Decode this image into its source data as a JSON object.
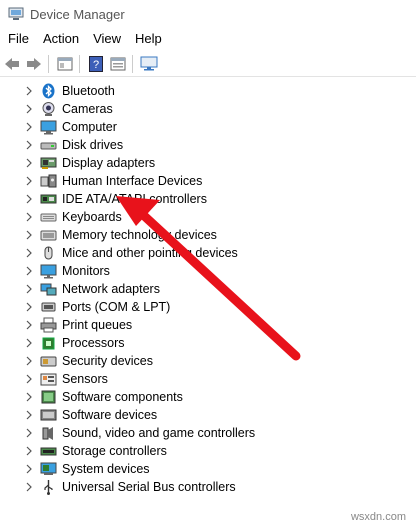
{
  "window": {
    "title": "Device Manager"
  },
  "menu": [
    "File",
    "Action",
    "View",
    "Help"
  ],
  "devices": [
    {
      "label": "Bluetooth",
      "icon": "bluetooth-icon"
    },
    {
      "label": "Cameras",
      "icon": "camera-icon"
    },
    {
      "label": "Computer",
      "icon": "computer-icon"
    },
    {
      "label": "Disk drives",
      "icon": "disk-drive-icon"
    },
    {
      "label": "Display adapters",
      "icon": "display-adapter-icon"
    },
    {
      "label": "Human Interface Devices",
      "icon": "hid-icon"
    },
    {
      "label": "IDE ATA/ATAPI controllers",
      "icon": "ide-controller-icon"
    },
    {
      "label": "Keyboards",
      "icon": "keyboard-icon"
    },
    {
      "label": "Memory technology devices",
      "icon": "memory-device-icon"
    },
    {
      "label": "Mice and other pointing devices",
      "icon": "mouse-icon"
    },
    {
      "label": "Monitors",
      "icon": "monitor-icon"
    },
    {
      "label": "Network adapters",
      "icon": "network-adapter-icon"
    },
    {
      "label": "Ports (COM & LPT)",
      "icon": "port-icon"
    },
    {
      "label": "Print queues",
      "icon": "printer-icon"
    },
    {
      "label": "Processors",
      "icon": "processor-icon"
    },
    {
      "label": "Security devices",
      "icon": "security-device-icon"
    },
    {
      "label": "Sensors",
      "icon": "sensor-icon"
    },
    {
      "label": "Software components",
      "icon": "software-component-icon"
    },
    {
      "label": "Software devices",
      "icon": "software-device-icon"
    },
    {
      "label": "Sound, video and game controllers",
      "icon": "sound-icon"
    },
    {
      "label": "Storage controllers",
      "icon": "storage-controller-icon"
    },
    {
      "label": "System devices",
      "icon": "system-device-icon"
    },
    {
      "label": "Universal Serial Bus controllers",
      "icon": "usb-icon"
    }
  ],
  "annotation": {
    "color": "#e8121b",
    "points_to": "Keyboards"
  },
  "watermark": "wsxdn.com"
}
